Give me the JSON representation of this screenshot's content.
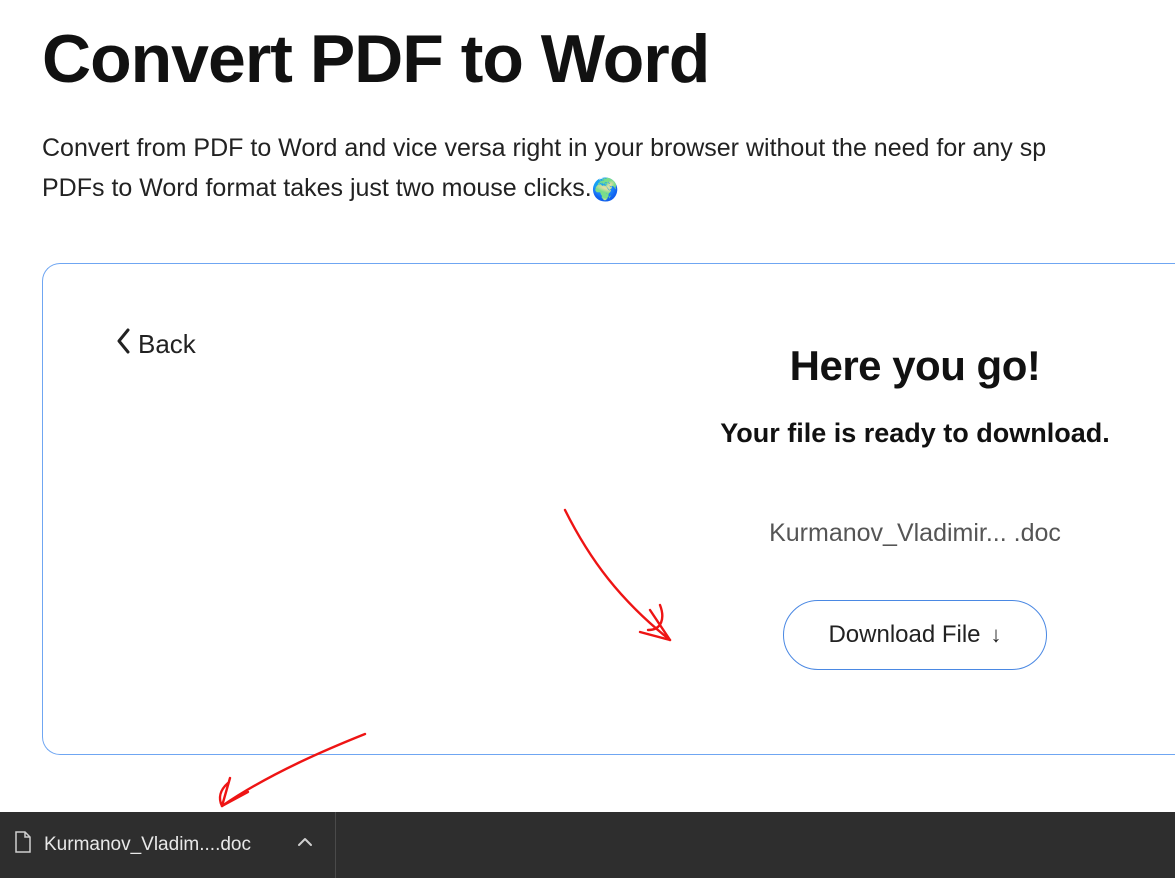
{
  "page": {
    "title": "Convert PDF to Word",
    "description_line1": "Convert from PDF to Word and vice versa right in your browser without the need for any sp",
    "description_line2": "PDFs to Word format takes just two mouse clicks.",
    "globe_emoji": "🌍"
  },
  "card": {
    "back_label": "Back",
    "result_heading": "Here you go!",
    "result_subtitle": "Your file is ready to download.",
    "filename": "Kurmanov_Vladimir...  .doc",
    "download_button_label": "Download File"
  },
  "download_shelf": {
    "item_label": "Kurmanov_Vladim....doc"
  }
}
